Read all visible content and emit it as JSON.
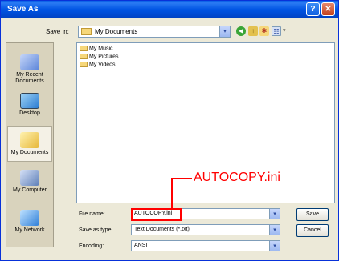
{
  "window": {
    "title": "Save As",
    "help_label": "?",
    "close_label": "✕"
  },
  "toolbar": {
    "save_in_label": "Save in:",
    "save_in_value": "My Documents",
    "views_drop": "▾"
  },
  "places": [
    {
      "label": "My Recent Documents",
      "icon": "recent-documents-icon"
    },
    {
      "label": "Desktop",
      "icon": "desktop-icon"
    },
    {
      "label": "My Documents",
      "icon": "my-documents-icon"
    },
    {
      "label": "My Computer",
      "icon": "my-computer-icon"
    },
    {
      "label": "My Network",
      "icon": "my-network-icon"
    }
  ],
  "files": [
    {
      "name": "My Music",
      "icon": "folder-icon"
    },
    {
      "name": "My Pictures",
      "icon": "folder-icon"
    },
    {
      "name": "My Videos",
      "icon": "folder-icon"
    }
  ],
  "form": {
    "file_name_label": "File name:",
    "file_name_value": "AUTOCOPY.ini",
    "save_as_type_label": "Save as type:",
    "save_as_type_value": "Text Documents (*.txt)",
    "encoding_label": "Encoding:",
    "encoding_value": "ANSI",
    "save_button": "Save",
    "cancel_button": "Cancel",
    "arrow": "▾"
  },
  "annotation": {
    "text": "AUTOCOPY.ini",
    "color": "#ff0000"
  }
}
